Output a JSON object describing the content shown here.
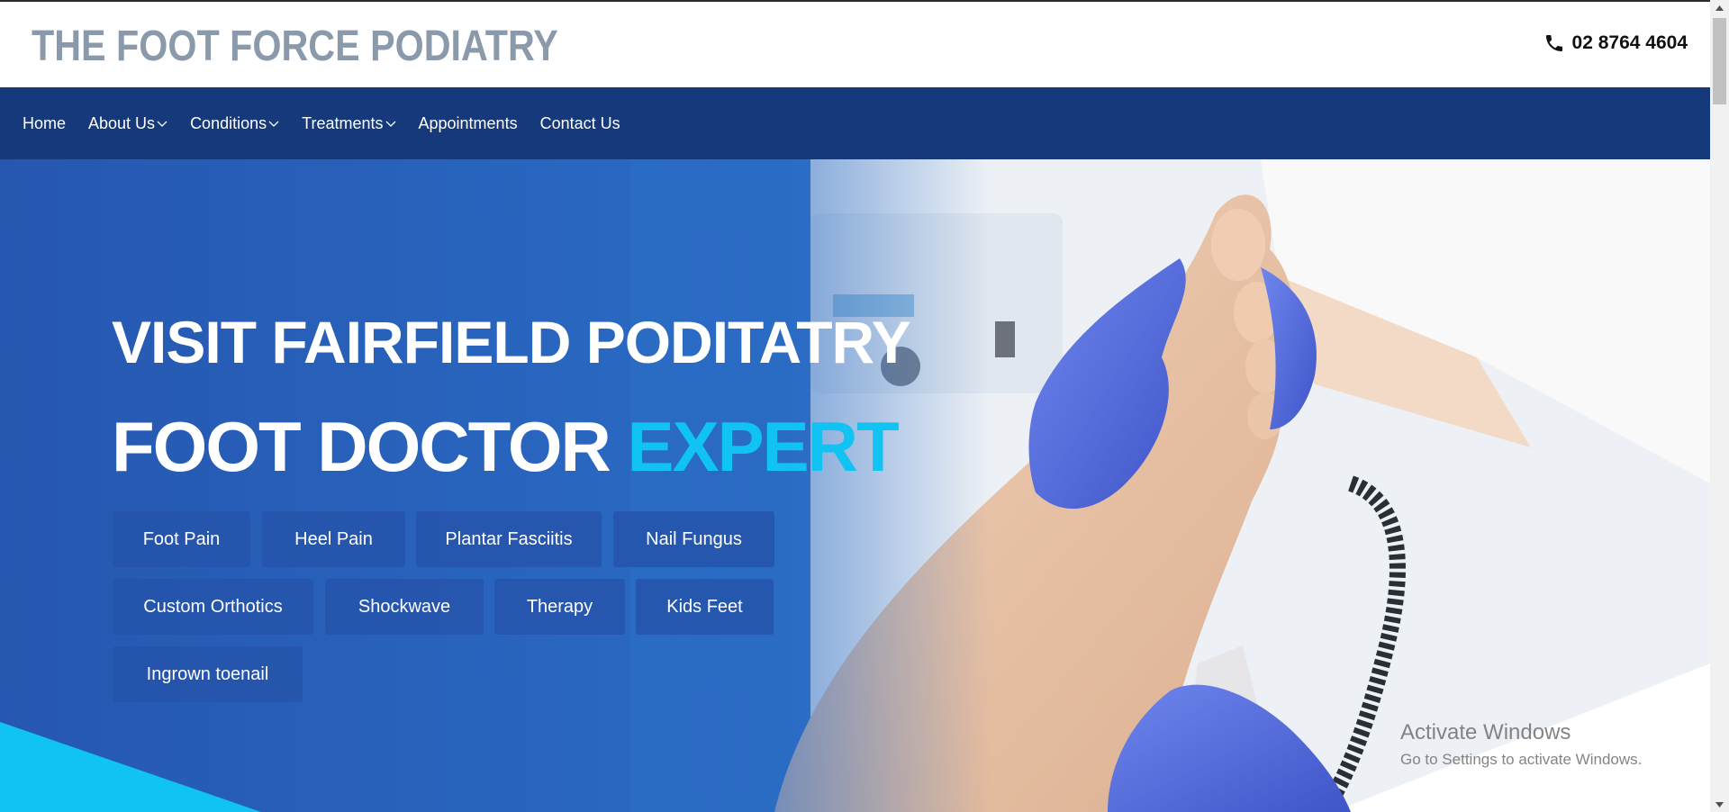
{
  "header": {
    "logo_text": "THE FOOT FORCE PODIATRY",
    "phone": "02 8764 4604"
  },
  "nav": {
    "items": [
      {
        "label": "Home",
        "has_dropdown": false
      },
      {
        "label": "About Us",
        "has_dropdown": true
      },
      {
        "label": "Conditions",
        "has_dropdown": true
      },
      {
        "label": "Treatments",
        "has_dropdown": true
      },
      {
        "label": "Appointments",
        "has_dropdown": false
      },
      {
        "label": "Contact Us",
        "has_dropdown": false
      }
    ]
  },
  "hero": {
    "title_line1": "VISIT FAIRFIELD PODITATRY",
    "title_line2_main": "FOOT DOCTOR",
    "title_line2_accent": "EXPERT",
    "tags": [
      "Foot Pain",
      "Heel Pain",
      "Plantar Fasciitis",
      "Nail Fungus",
      "Custom Orthotics",
      "Shockwave",
      "Therapy",
      "Kids Feet",
      "Ingrown toenail"
    ]
  },
  "watermark": {
    "line1": "Activate Windows",
    "line2": "Go to Settings to activate Windows."
  },
  "colors": {
    "nav_bg": "#15397a",
    "hero_blue": "#2657b0",
    "accent": "#10c3f2",
    "logo": "#8a9aaa"
  }
}
